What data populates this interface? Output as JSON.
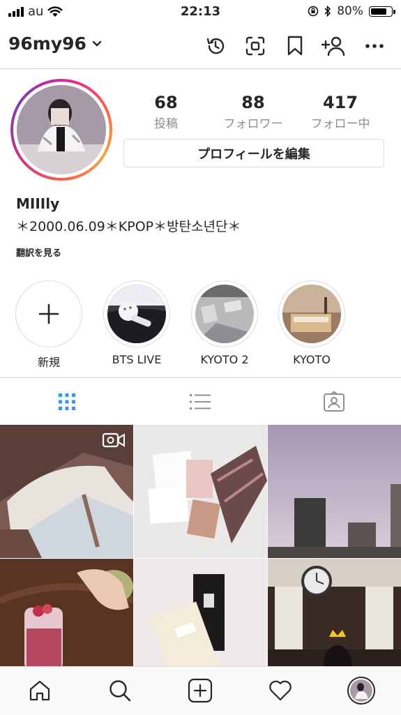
{
  "status_bar": {
    "carrier": "au",
    "time": "22:13",
    "battery": "80%",
    "battery_level": 0.8
  },
  "header": {
    "username": "96my96"
  },
  "profile": {
    "posts_count": "68",
    "posts_label": "投稿",
    "followers_count": "88",
    "followers_label": "フォロワー",
    "following_count": "417",
    "following_label": "フォロー中",
    "edit_profile_label": "プロフィールを編集",
    "display_name": "MIIIly",
    "bio": "＊2000.06.09＊KPOP＊방탄소년단＊",
    "translate_label": "翻訳を見る"
  },
  "highlights": [
    {
      "title": "新規"
    },
    {
      "title": "BTS LIVE"
    },
    {
      "title": "KYOTO 2"
    },
    {
      "title": "KYOTO"
    }
  ],
  "icons": {
    "history": "history-icon",
    "scan": "scan-icon",
    "bookmark": "bookmark-icon",
    "add_person": "add-person-icon",
    "more": "more-icon",
    "grid": "grid-icon",
    "list": "list-icon",
    "tagged": "tagged-icon",
    "home": "home-icon",
    "search": "search-icon",
    "add": "add-icon",
    "activity": "heart-icon",
    "profile": "avatar"
  },
  "colors": {
    "accent": "#3897f0",
    "text": "#262626",
    "secondary": "#8e8e8e",
    "border": "#dbdbdb"
  }
}
